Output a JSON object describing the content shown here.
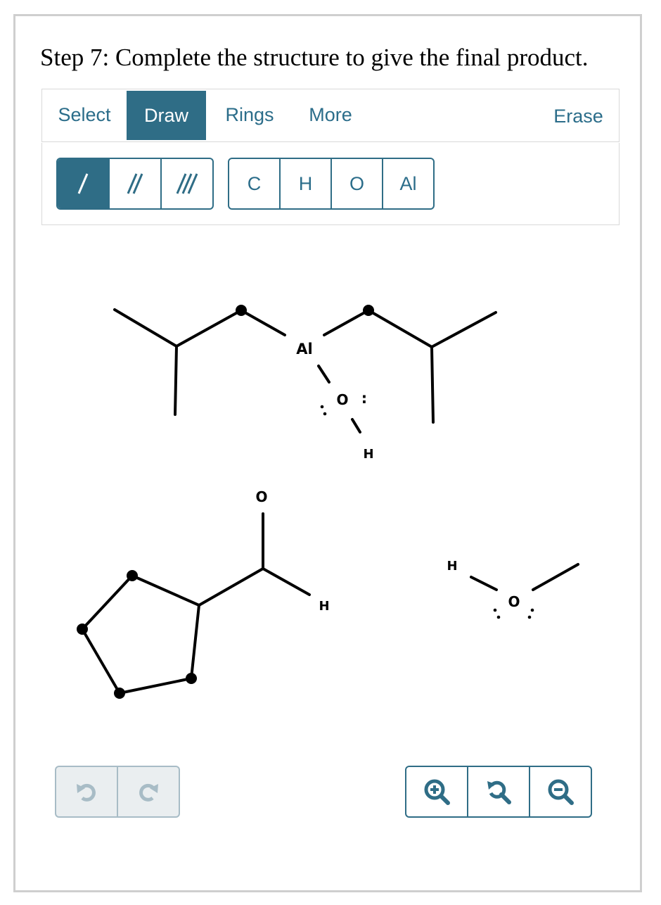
{
  "step_title": "Step 7: Complete the structure to give the final product.",
  "tabs": {
    "select": "Select",
    "draw": "Draw",
    "rings": "Rings",
    "more": "More",
    "erase": "Erase"
  },
  "atoms": [
    "C",
    "H",
    "O",
    "Al"
  ],
  "canvas_labels": {
    "al": "Al",
    "o_top": "O",
    "lone_pair_colon": ":",
    "h_top": "H",
    "o_aldehyde": "O",
    "h_aldehyde": "H",
    "h_methanol": "H",
    "o_methanol": "O"
  },
  "colors": {
    "accent": "#2f6d86",
    "border": "#cfcfcf",
    "disabled": "#a8bcc6"
  },
  "icons": [
    "single-bond-icon",
    "double-bond-icon",
    "triple-bond-icon",
    "undo-icon",
    "redo-icon",
    "zoom-in-icon",
    "zoom-reset-icon",
    "zoom-out-icon"
  ]
}
